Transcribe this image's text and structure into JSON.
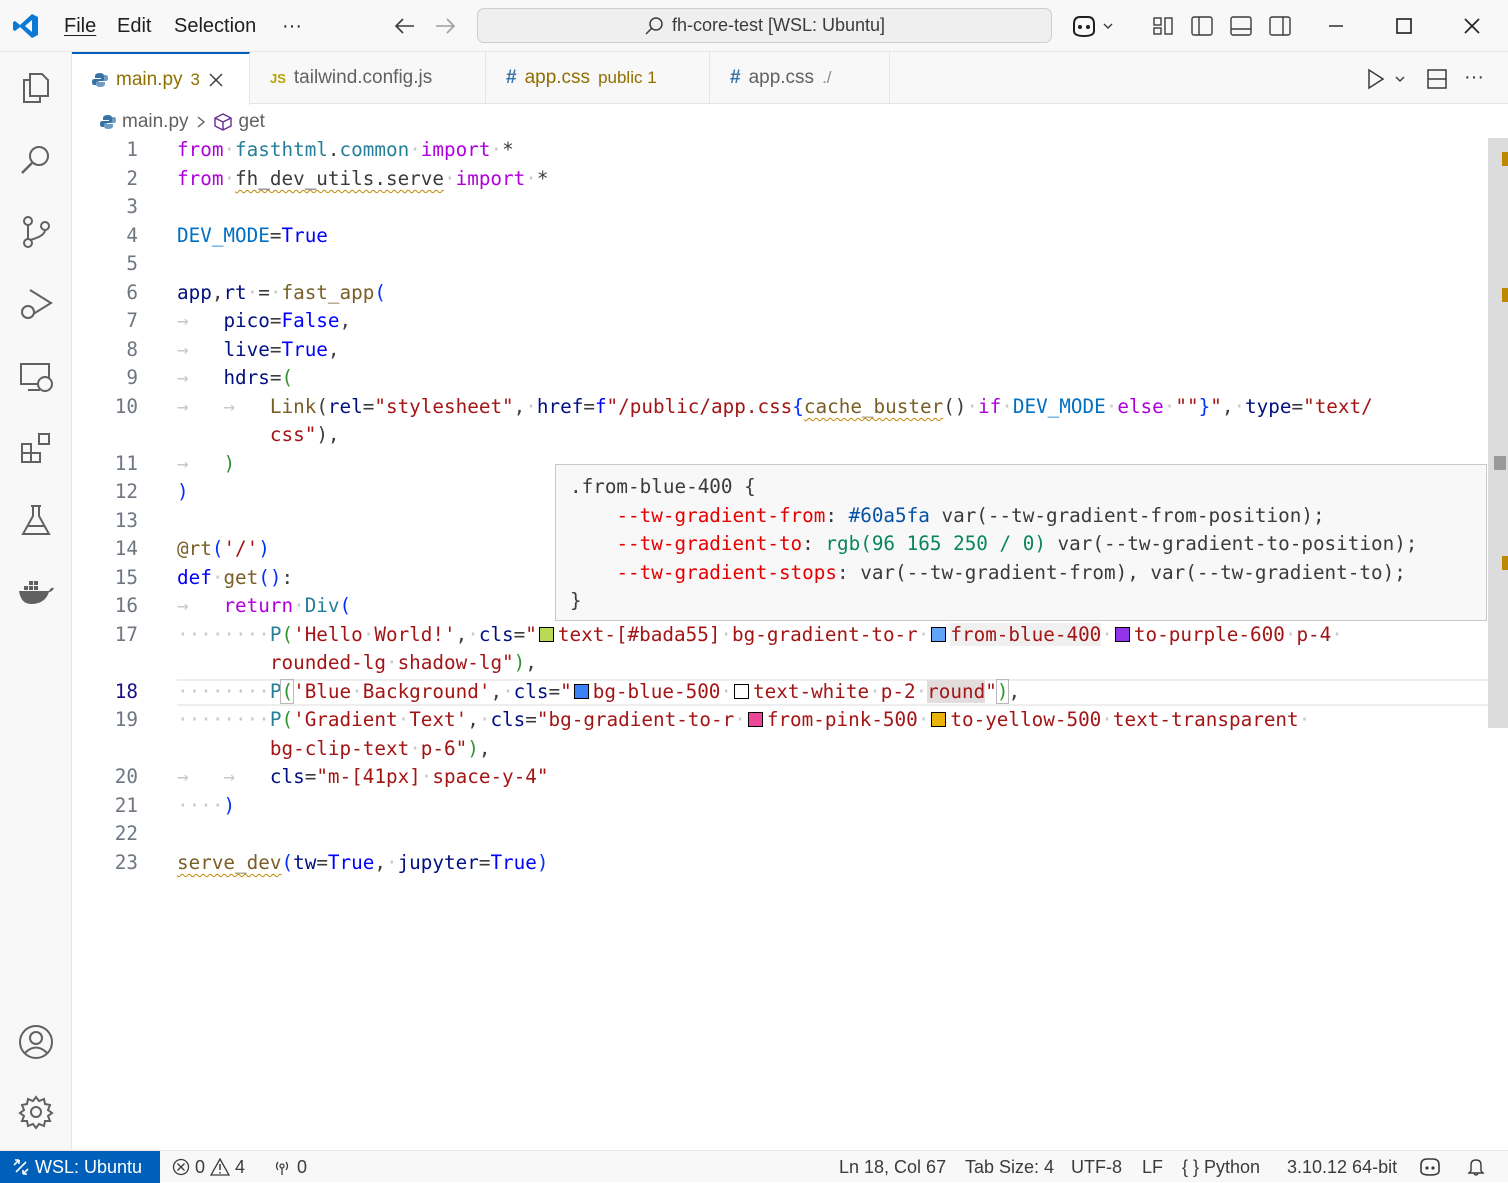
{
  "menu": {
    "file": "File",
    "edit": "Edit",
    "selection": "Selection",
    "more": "···"
  },
  "search": {
    "text": "fh-core-test [WSL: Ubuntu]"
  },
  "tabs": [
    {
      "label": "main.py",
      "badge": "3",
      "icon": "python-icon"
    },
    {
      "label": "tailwind.config.js",
      "icon": "js-icon",
      "icon_text": "JS"
    },
    {
      "label": "app.css",
      "badge": "public 1",
      "icon": "css-hash-icon",
      "icon_text": "#"
    },
    {
      "label": "app.css",
      "badge": "./",
      "icon": "css-hash-icon",
      "icon_text": "#"
    }
  ],
  "breadcrumb": {
    "file": "main.py",
    "symbol": "get"
  },
  "line_numbers": [
    "1",
    "2",
    "3",
    "4",
    "5",
    "6",
    "7",
    "8",
    "9",
    "10",
    "11",
    "12",
    "13",
    "14",
    "15",
    "16",
    "17",
    "18",
    "19",
    "20",
    "21",
    "22",
    "23"
  ],
  "hover": {
    "selector": ".from-blue-400 {",
    "p1": "--tw-gradient-from",
    "p1v": "#60a5fa",
    "p1rest": " var(--tw-gradient-from-position);",
    "p2": "--tw-gradient-to",
    "p2v": "rgb(96 165 250 / 0)",
    "p2rest": " var(--tw-gradient-to-position);",
    "p3": "--tw-gradient-stops",
    "p3rest": " var(--tw-gradient-from), var(--tw-gradient-to);",
    "close": "}"
  },
  "colors": {
    "accent": "#005fb8",
    "status_remote": "#005fb8",
    "swatch_bada55": "#bada55",
    "swatch_blue400": "#60a5fa",
    "swatch_purple600": "#9333ea",
    "swatch_blue500": "#3b82f6",
    "swatch_white": "#ffffff",
    "swatch_pink500": "#ec4899",
    "swatch_yellow500": "#eab308"
  },
  "status": {
    "remote": "WSL: Ubuntu",
    "errors": "0",
    "warnings": "4",
    "ports": "0",
    "position": "Ln 18, Col 67",
    "tab_size": "Tab Size: 4",
    "encoding": "UTF-8",
    "eol": "LF",
    "language": "Python",
    "interpreter": "3.10.12 64-bit"
  }
}
